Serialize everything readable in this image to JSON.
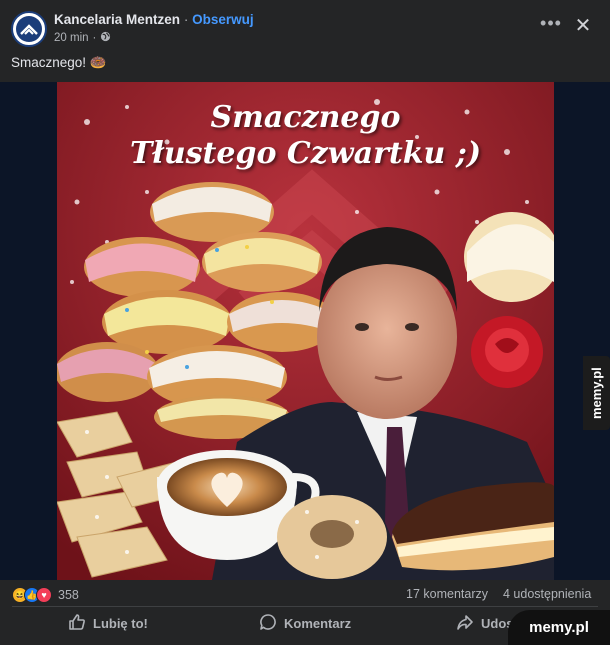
{
  "post": {
    "page_name": "Kancelaria Mentzen",
    "separator": "·",
    "follow_label": "Obserwuj",
    "time": "20 min",
    "meta_dot": "·",
    "caption": "Smacznego! 🍩"
  },
  "image": {
    "line1": "Smacznego",
    "line2": "Tłustego Czwartku ;)",
    "side_watermark": "memy.pl"
  },
  "stats": {
    "reaction_icons": [
      "haha-icon",
      "like-icon",
      "love-icon"
    ],
    "reaction_count": "358",
    "comments": "17 komentarzy",
    "shares": "4 udostępnienia"
  },
  "actions": {
    "like": "Lubię to!",
    "comment": "Komentarz",
    "share": "Udostępnij"
  },
  "watermark": "memy.pl",
  "colors": {
    "background": "#242526",
    "text": "#e4e6eb",
    "secondary_text": "#b0b3b8",
    "follow": "#4599ff",
    "like_blue": "#1877f2",
    "love_red": "#f33e58",
    "haha_yellow": "#f7b125"
  }
}
